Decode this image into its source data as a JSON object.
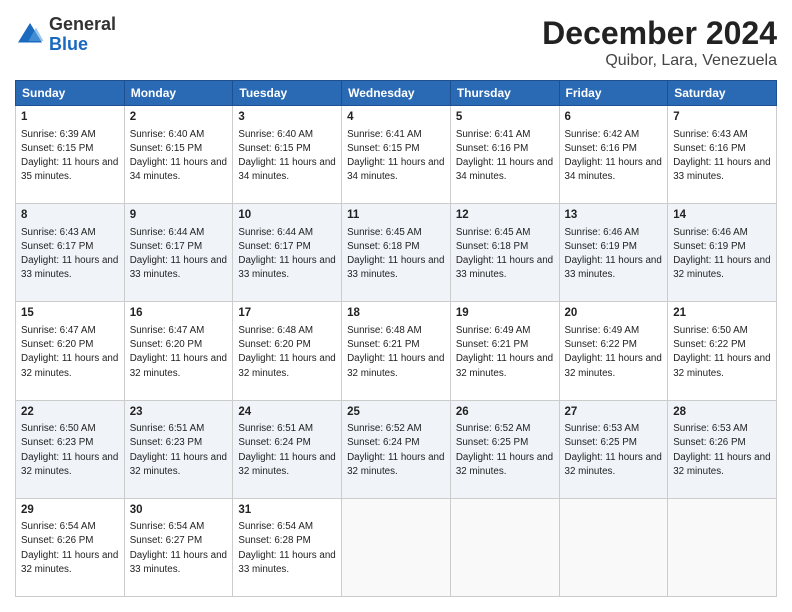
{
  "header": {
    "logo_line1": "General",
    "logo_line2": "Blue",
    "title": "December 2024",
    "subtitle": "Quibor, Lara, Venezuela"
  },
  "weekdays": [
    "Sunday",
    "Monday",
    "Tuesday",
    "Wednesday",
    "Thursday",
    "Friday",
    "Saturday"
  ],
  "weeks": [
    [
      {
        "day": "1",
        "sunrise": "6:39 AM",
        "sunset": "6:15 PM",
        "daylight": "11 hours and 35 minutes."
      },
      {
        "day": "2",
        "sunrise": "6:40 AM",
        "sunset": "6:15 PM",
        "daylight": "11 hours and 34 minutes."
      },
      {
        "day": "3",
        "sunrise": "6:40 AM",
        "sunset": "6:15 PM",
        "daylight": "11 hours and 34 minutes."
      },
      {
        "day": "4",
        "sunrise": "6:41 AM",
        "sunset": "6:15 PM",
        "daylight": "11 hours and 34 minutes."
      },
      {
        "day": "5",
        "sunrise": "6:41 AM",
        "sunset": "6:16 PM",
        "daylight": "11 hours and 34 minutes."
      },
      {
        "day": "6",
        "sunrise": "6:42 AM",
        "sunset": "6:16 PM",
        "daylight": "11 hours and 34 minutes."
      },
      {
        "day": "7",
        "sunrise": "6:43 AM",
        "sunset": "6:16 PM",
        "daylight": "11 hours and 33 minutes."
      }
    ],
    [
      {
        "day": "8",
        "sunrise": "6:43 AM",
        "sunset": "6:17 PM",
        "daylight": "11 hours and 33 minutes."
      },
      {
        "day": "9",
        "sunrise": "6:44 AM",
        "sunset": "6:17 PM",
        "daylight": "11 hours and 33 minutes."
      },
      {
        "day": "10",
        "sunrise": "6:44 AM",
        "sunset": "6:17 PM",
        "daylight": "11 hours and 33 minutes."
      },
      {
        "day": "11",
        "sunrise": "6:45 AM",
        "sunset": "6:18 PM",
        "daylight": "11 hours and 33 minutes."
      },
      {
        "day": "12",
        "sunrise": "6:45 AM",
        "sunset": "6:18 PM",
        "daylight": "11 hours and 33 minutes."
      },
      {
        "day": "13",
        "sunrise": "6:46 AM",
        "sunset": "6:19 PM",
        "daylight": "11 hours and 33 minutes."
      },
      {
        "day": "14",
        "sunrise": "6:46 AM",
        "sunset": "6:19 PM",
        "daylight": "11 hours and 32 minutes."
      }
    ],
    [
      {
        "day": "15",
        "sunrise": "6:47 AM",
        "sunset": "6:20 PM",
        "daylight": "11 hours and 32 minutes."
      },
      {
        "day": "16",
        "sunrise": "6:47 AM",
        "sunset": "6:20 PM",
        "daylight": "11 hours and 32 minutes."
      },
      {
        "day": "17",
        "sunrise": "6:48 AM",
        "sunset": "6:20 PM",
        "daylight": "11 hours and 32 minutes."
      },
      {
        "day": "18",
        "sunrise": "6:48 AM",
        "sunset": "6:21 PM",
        "daylight": "11 hours and 32 minutes."
      },
      {
        "day": "19",
        "sunrise": "6:49 AM",
        "sunset": "6:21 PM",
        "daylight": "11 hours and 32 minutes."
      },
      {
        "day": "20",
        "sunrise": "6:49 AM",
        "sunset": "6:22 PM",
        "daylight": "11 hours and 32 minutes."
      },
      {
        "day": "21",
        "sunrise": "6:50 AM",
        "sunset": "6:22 PM",
        "daylight": "11 hours and 32 minutes."
      }
    ],
    [
      {
        "day": "22",
        "sunrise": "6:50 AM",
        "sunset": "6:23 PM",
        "daylight": "11 hours and 32 minutes."
      },
      {
        "day": "23",
        "sunrise": "6:51 AM",
        "sunset": "6:23 PM",
        "daylight": "11 hours and 32 minutes."
      },
      {
        "day": "24",
        "sunrise": "6:51 AM",
        "sunset": "6:24 PM",
        "daylight": "11 hours and 32 minutes."
      },
      {
        "day": "25",
        "sunrise": "6:52 AM",
        "sunset": "6:24 PM",
        "daylight": "11 hours and 32 minutes."
      },
      {
        "day": "26",
        "sunrise": "6:52 AM",
        "sunset": "6:25 PM",
        "daylight": "11 hours and 32 minutes."
      },
      {
        "day": "27",
        "sunrise": "6:53 AM",
        "sunset": "6:25 PM",
        "daylight": "11 hours and 32 minutes."
      },
      {
        "day": "28",
        "sunrise": "6:53 AM",
        "sunset": "6:26 PM",
        "daylight": "11 hours and 32 minutes."
      }
    ],
    [
      {
        "day": "29",
        "sunrise": "6:54 AM",
        "sunset": "6:26 PM",
        "daylight": "11 hours and 32 minutes."
      },
      {
        "day": "30",
        "sunrise": "6:54 AM",
        "sunset": "6:27 PM",
        "daylight": "11 hours and 33 minutes."
      },
      {
        "day": "31",
        "sunrise": "6:54 AM",
        "sunset": "6:28 PM",
        "daylight": "11 hours and 33 minutes."
      },
      null,
      null,
      null,
      null
    ]
  ]
}
